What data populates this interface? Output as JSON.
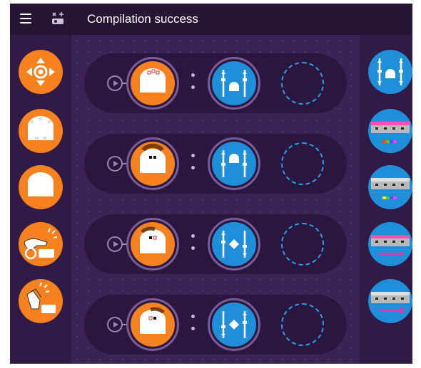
{
  "header": {
    "menu_icon": "hamburger-menu-icon",
    "robot_icon": "robot-status-icon",
    "title": "Compilation success"
  },
  "colors": {
    "background": "#2f1842",
    "event_orange": "#f5821f",
    "action_blue": "#1f8fd9",
    "empty_slot": "#27a0e6"
  },
  "left_palette": [
    {
      "name": "buttons-event",
      "icon": "arrow-buttons-icon"
    },
    {
      "name": "ground-sensors-event",
      "icon": "robot-ground-sensors-icon"
    },
    {
      "name": "proximity-event",
      "icon": "robot-proximity-icon"
    },
    {
      "name": "tap-event",
      "icon": "tap-robot-icon"
    },
    {
      "name": "clap-event",
      "icon": "clap-robot-icon"
    }
  ],
  "right_palette": [
    {
      "name": "motors-action",
      "icon": "motors-icon"
    },
    {
      "name": "top-color-action",
      "icon": "top-color-icon"
    },
    {
      "name": "bottom-color-action",
      "icon": "bottom-color-icon"
    },
    {
      "name": "sound-action",
      "icon": "sound-icon"
    },
    {
      "name": "timer-action",
      "icon": "timer-icon"
    }
  ],
  "program_rows": [
    {
      "event": "proximity-front-red",
      "action": "move-forward"
    },
    {
      "event": "proximity-front-black",
      "action": "move-forward-up"
    },
    {
      "event": "ground-left",
      "action": "turn-right"
    },
    {
      "event": "ground-left-red",
      "action": "turn-left"
    }
  ]
}
